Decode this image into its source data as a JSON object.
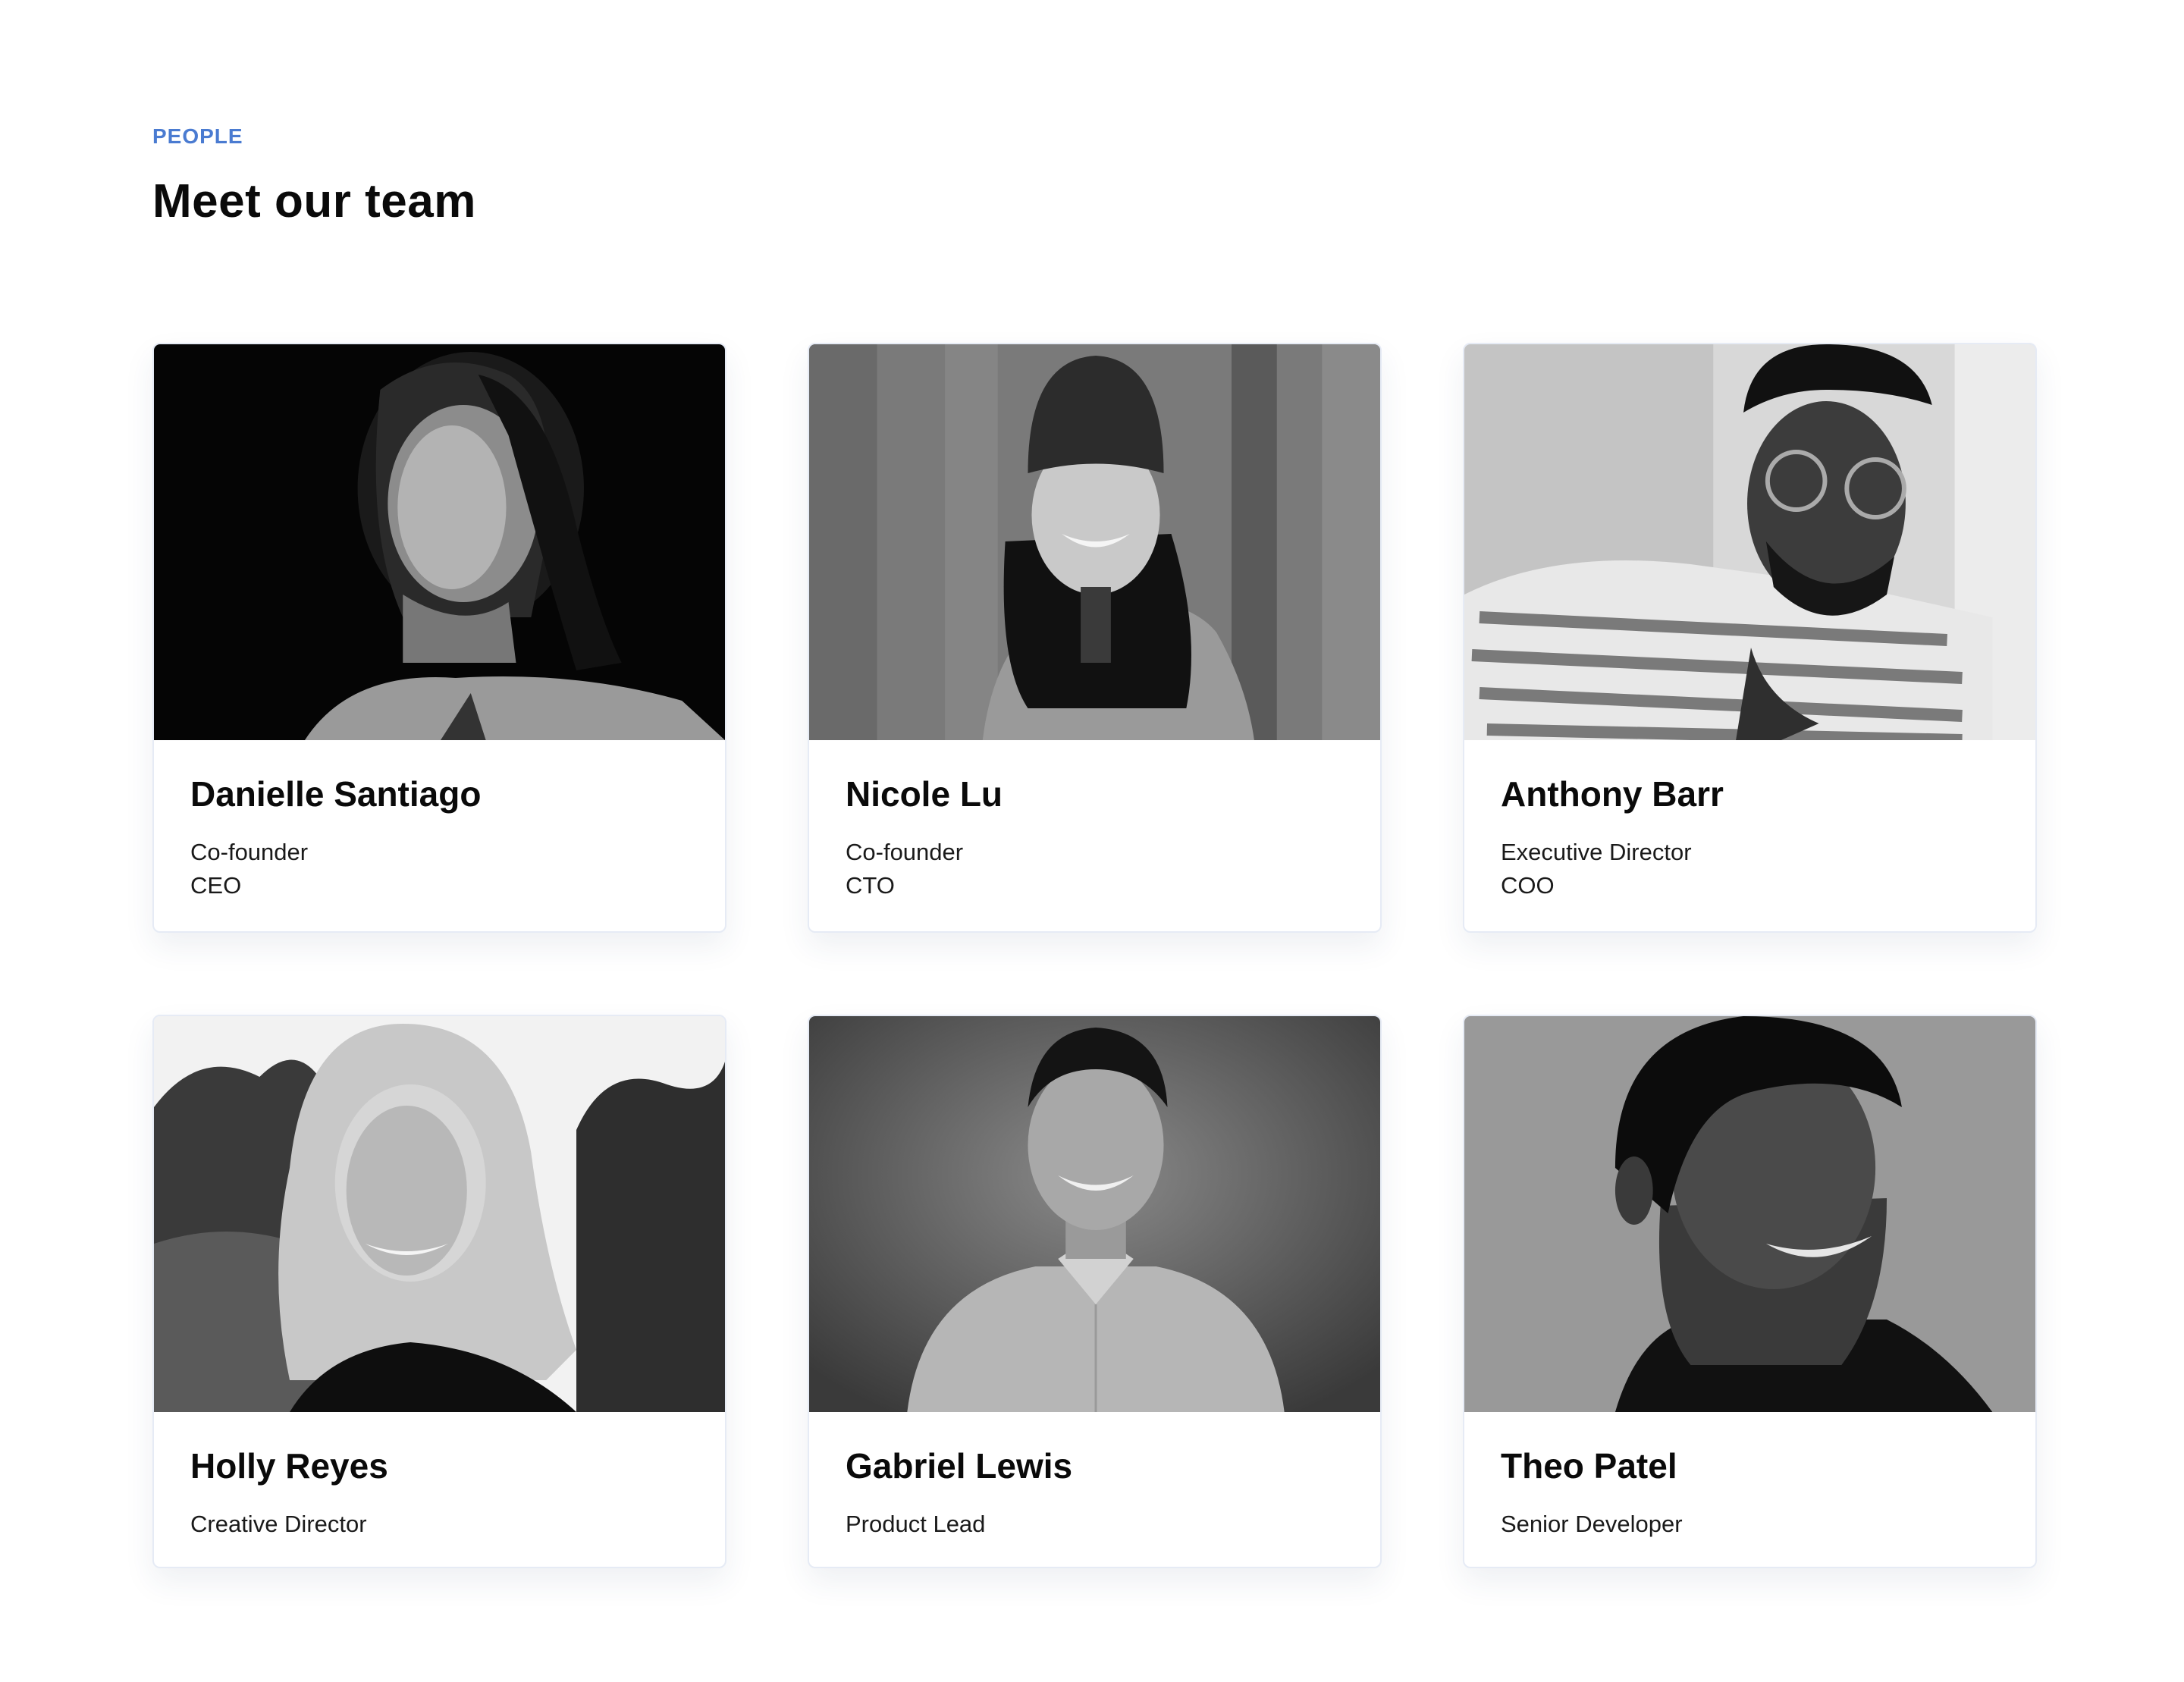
{
  "section": {
    "eyebrow": "PEOPLE",
    "title": "Meet our team"
  },
  "team": [
    {
      "name": "Danielle Santiago",
      "roles": [
        "Co-founder",
        "CEO"
      ],
      "photo": "portrait-woman-dark-background-icon"
    },
    {
      "name": "Nicole Lu",
      "roles": [
        "Co-founder",
        "CTO"
      ],
      "photo": "portrait-woman-beanie-icon"
    },
    {
      "name": "Anthony Barr",
      "roles": [
        "Executive Director",
        "COO"
      ],
      "photo": "portrait-man-glasses-icon"
    },
    {
      "name": "Holly Reyes",
      "roles": [
        "Creative Director"
      ],
      "photo": "portrait-woman-blonde-icon"
    },
    {
      "name": "Gabriel Lewis",
      "roles": [
        "Product Lead"
      ],
      "photo": "portrait-man-shirt-icon"
    },
    {
      "name": "Theo Patel",
      "roles": [
        "Senior Developer"
      ],
      "photo": "portrait-man-profile-icon"
    }
  ],
  "colors": {
    "accent": "#4a7bd1",
    "heading": "#0a0a0a",
    "card_border": "#e6ebf5"
  }
}
